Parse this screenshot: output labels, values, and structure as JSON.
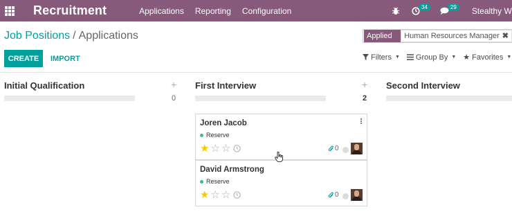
{
  "navbar": {
    "app_title": "Recruitment",
    "menu": [
      "Applications",
      "Reporting",
      "Configuration"
    ],
    "activity_count": "34",
    "message_count": "29",
    "user": "Stealthy Wo"
  },
  "breadcrumb": {
    "parent": "Job Positions",
    "separator": "/",
    "current": "Applications"
  },
  "search": {
    "facet_label": "Applied Job",
    "facet_value": "Human Resources Manager",
    "remove": "✖"
  },
  "buttons": {
    "create": "CREATE",
    "import": "IMPORT"
  },
  "search_options": {
    "filters": "Filters",
    "group_by": "Group By",
    "favorites": "Favorites"
  },
  "kanban": {
    "columns": [
      {
        "title": "Initial Qualification",
        "add": "+",
        "count": "0"
      },
      {
        "title": "First Interview",
        "add": "+",
        "count": "2"
      },
      {
        "title": "Second Interview"
      }
    ],
    "cards": [
      {
        "name": "Joren Jacob",
        "tag": "Reserve",
        "stars_filled": 1,
        "stars_total": 3,
        "attachments": "0"
      },
      {
        "name": "David Armstrong",
        "tag": "Reserve",
        "stars_filled": 1,
        "stars_total": 3,
        "attachments": "0"
      }
    ]
  },
  "colors": {
    "navbar": "#875a7b",
    "accent": "#00a09d",
    "tag_dot": "#30c381",
    "star_on": "#f3cc00"
  }
}
